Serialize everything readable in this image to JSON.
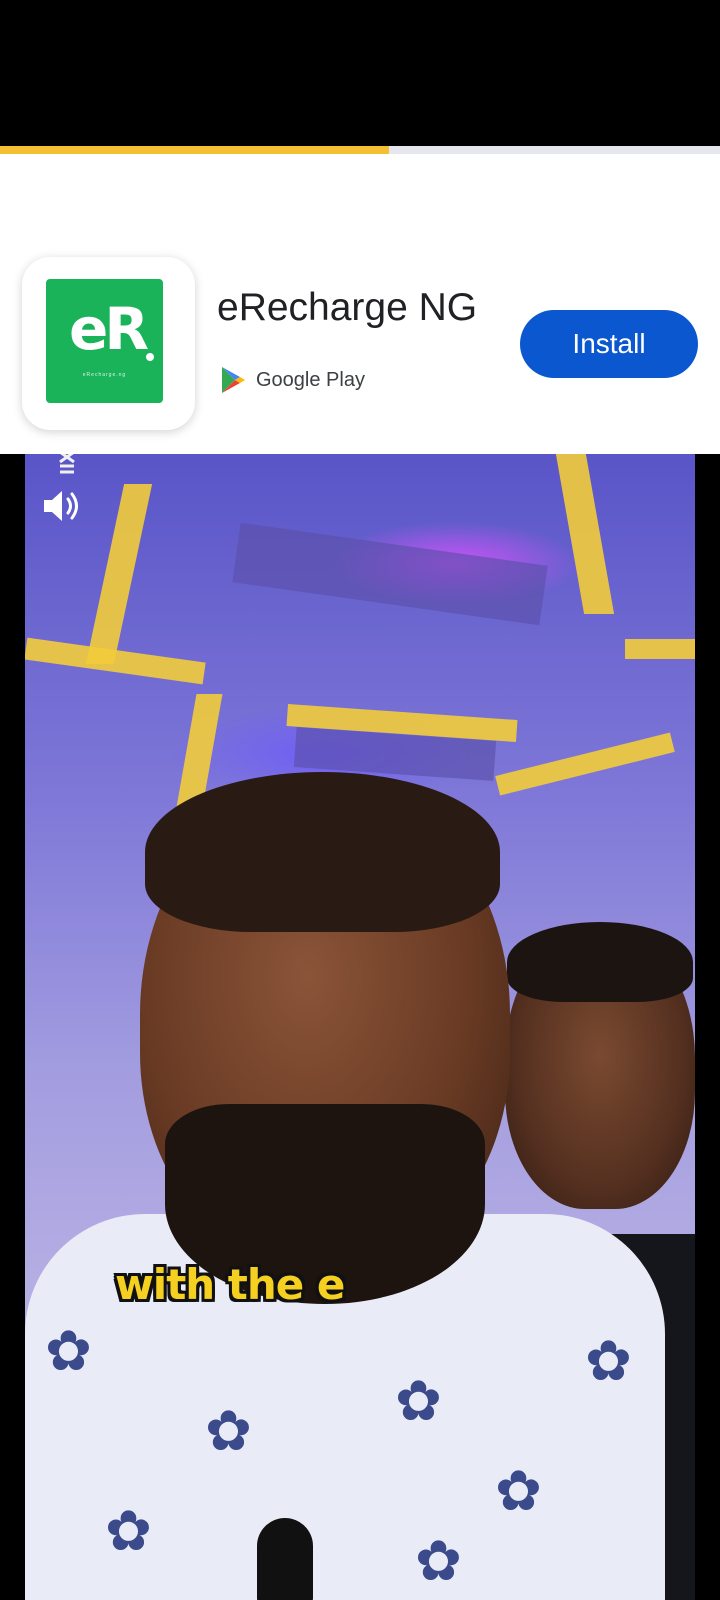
{
  "progress": {
    "fraction": 0.54,
    "fill_color": "#f2c030"
  },
  "ad": {
    "app_icon": {
      "name": "erecharge-logo-icon",
      "logo_text": "eR",
      "subtext": "eRecharge.ng",
      "color": "#1ab35a"
    },
    "app_name": "eRecharge NG",
    "store_icon": "google-play-icon",
    "store_label": "Google Play",
    "install_label": "Install",
    "install_color": "#0b57d0"
  },
  "video": {
    "mute_icon": "volume-icon",
    "caption": "with the e",
    "caption_color": "#f5d020"
  }
}
